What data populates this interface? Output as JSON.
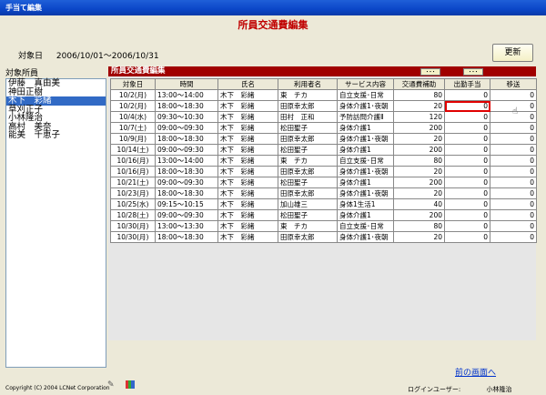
{
  "window": {
    "title": "手当て編集"
  },
  "page": {
    "title": "所員交通費編集"
  },
  "target_date": {
    "label": "対象日",
    "value": "2006/10/01～2006/10/31"
  },
  "toolbar": {
    "update_label": "更新"
  },
  "staff": {
    "label": "対象所員",
    "items": [
      "伊藤　真由美",
      "神田正樹",
      "木下　彩緒",
      "草刈正子",
      "小林隆治",
      "高村　美奈",
      "能美　千恵子"
    ],
    "selected_index": 2
  },
  "panel": {
    "title": "所員交通費編集",
    "dots_label": "･･･"
  },
  "table": {
    "columns": [
      "対象日",
      "時間",
      "氏名",
      "利用者名",
      "サービス内容",
      "交通費補助",
      "出勤手当",
      "移送"
    ],
    "rows": [
      [
        "10/2(月)",
        "13:00～14:00",
        "木下　彩緒",
        "東　チカ",
        "自立支援･日常",
        "80",
        "0",
        "0"
      ],
      [
        "10/2(月)",
        "18:00～18:30",
        "木下　彩緒",
        "田原幸太郎",
        "身体介護1･夜朝",
        "20",
        "0",
        "0"
      ],
      [
        "10/4(水)",
        "09:30～10:30",
        "木下　彩緒",
        "田村　正和",
        "予防訪問介護Ⅱ",
        "120",
        "0",
        "0"
      ],
      [
        "10/7(土)",
        "09:00～09:30",
        "木下　彩緒",
        "松田聖子",
        "身体介護1",
        "200",
        "0",
        "0"
      ],
      [
        "10/9(月)",
        "18:00～18:30",
        "木下　彩緒",
        "田原幸太郎",
        "身体介護1･夜朝",
        "20",
        "0",
        "0"
      ],
      [
        "10/14(土)",
        "09:00～09:30",
        "木下　彩緒",
        "松田聖子",
        "身体介護1",
        "200",
        "0",
        "0"
      ],
      [
        "10/16(月)",
        "13:00～14:00",
        "木下　彩緒",
        "東　チカ",
        "自立支援･日常",
        "80",
        "0",
        "0"
      ],
      [
        "10/16(月)",
        "18:00～18:30",
        "木下　彩緒",
        "田原幸太郎",
        "身体介護1･夜朝",
        "20",
        "0",
        "0"
      ],
      [
        "10/21(土)",
        "09:00～09:30",
        "木下　彩緒",
        "松田聖子",
        "身体介護1",
        "200",
        "0",
        "0"
      ],
      [
        "10/23(月)",
        "18:00～18:30",
        "木下　彩緒",
        "田原幸太郎",
        "身体介護1･夜朝",
        "20",
        "0",
        "0"
      ],
      [
        "10/25(水)",
        "09:15～10:15",
        "木下　彩緒",
        "加山雄三",
        "身体1生活1",
        "40",
        "0",
        "0"
      ],
      [
        "10/28(土)",
        "09:00～09:30",
        "木下　彩緒",
        "松田聖子",
        "身体介護1",
        "200",
        "0",
        "0"
      ],
      [
        "10/30(月)",
        "13:00～13:30",
        "木下　彩緒",
        "東　チカ",
        "自立支援･日常",
        "80",
        "0",
        "0"
      ],
      [
        "10/30(月)",
        "18:00～18:30",
        "木下　彩緒",
        "田原幸太郎",
        "身体介護1･夜朝",
        "20",
        "0",
        "0"
      ]
    ],
    "highlight": {
      "row": 1,
      "col": 6
    }
  },
  "footer": {
    "back_link": "前の画面へ",
    "copyright": "Copyright (C) 2004 LCNet Corporation",
    "login_label": "ログインユーザー:",
    "login_user": "小林隆治"
  }
}
